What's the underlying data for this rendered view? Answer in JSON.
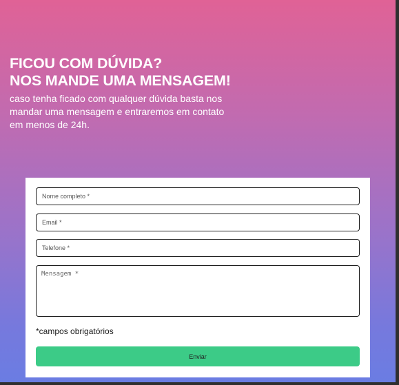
{
  "hero": {
    "title_line1": "FICOU COM DÚVIDA?",
    "title_line2": "NOS MANDE UMA MENSAGEM!",
    "description": "caso tenha ficado com qualquer dúvida basta nos mandar uma mensagem e entraremos em contato em menos de 24h."
  },
  "form": {
    "name_placeholder": "Nome completo *",
    "email_placeholder": "Email *",
    "phone_placeholder": "Telefone *",
    "message_placeholder": "Mensagem *",
    "required_note": "*campos obrigatórios",
    "submit_label": "Enviar"
  },
  "colors": {
    "gradient_top": "#e06296",
    "gradient_bottom": "#6a7de3",
    "submit_button": "#3ccb87"
  }
}
